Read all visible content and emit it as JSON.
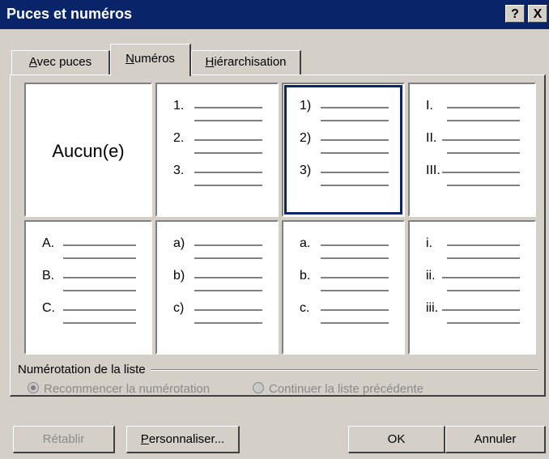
{
  "window": {
    "title": "Puces et numéros"
  },
  "titlebar_buttons": {
    "help": "?",
    "close": "X"
  },
  "tabs": [
    {
      "accel": "A",
      "rest": "vec puces"
    },
    {
      "accel": "N",
      "rest": "uméros"
    },
    {
      "accel": "H",
      "rest": "iérarchisation"
    }
  ],
  "gallery": {
    "none_label": "Aucun(e)",
    "styles": [
      [],
      [
        "1.",
        "2.",
        "3."
      ],
      [
        "1)",
        "2)",
        "3)"
      ],
      [
        "I.",
        "II.",
        "III."
      ],
      [
        "A.",
        "B.",
        "C."
      ],
      [
        "a)",
        "b)",
        "c)"
      ],
      [
        "a.",
        "b.",
        "c."
      ],
      [
        "i.",
        "ii.",
        "iii."
      ]
    ],
    "selected_index": 2
  },
  "numbering": {
    "label": "Numérotation de la liste",
    "restart": "Recommencer la numérotation",
    "continue": "Continuer la liste précédente",
    "selected": "restart"
  },
  "buttons": {
    "reset": "Rétablir",
    "customize_accel": "P",
    "customize_rest": "ersonnaliser...",
    "ok": "OK",
    "cancel": "Annuler"
  }
}
